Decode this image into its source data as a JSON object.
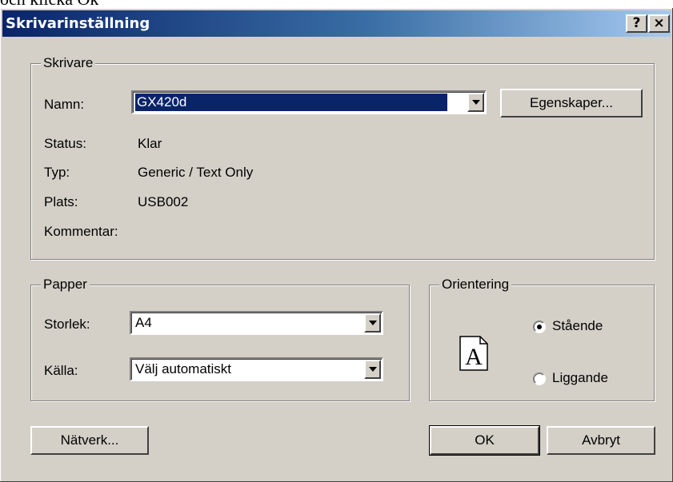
{
  "background_caption": "och klicka Ok",
  "window": {
    "title": "Skrivarinställning",
    "help_button": "?",
    "close_button": "×"
  },
  "printer": {
    "legend": "Skrivare",
    "name_label": "Namn:",
    "name_value": "GX420d",
    "properties_button": "Egenskaper...",
    "status_label": "Status:",
    "status_value": "Klar",
    "type_label": "Typ:",
    "type_value": "Generic / Text Only",
    "location_label": "Plats:",
    "location_value": "USB002",
    "comment_label": "Kommentar:"
  },
  "paper": {
    "legend": "Papper",
    "size_label": "Storlek:",
    "size_value": "A4",
    "source_label": "Källa:",
    "source_value": "Välj automatiskt"
  },
  "orientation": {
    "legend": "Orientering",
    "page_letter": "A",
    "portrait_label": "Stående",
    "landscape_label": "Liggande",
    "selected": "portrait"
  },
  "buttons": {
    "network": "Nätverk...",
    "ok": "OK",
    "cancel": "Avbryt"
  },
  "colors": {
    "dialog_face": "#d4d0c8",
    "title_gradient_start": "#0a246a",
    "title_gradient_end": "#a6caf0",
    "selection": "#0a246a"
  }
}
